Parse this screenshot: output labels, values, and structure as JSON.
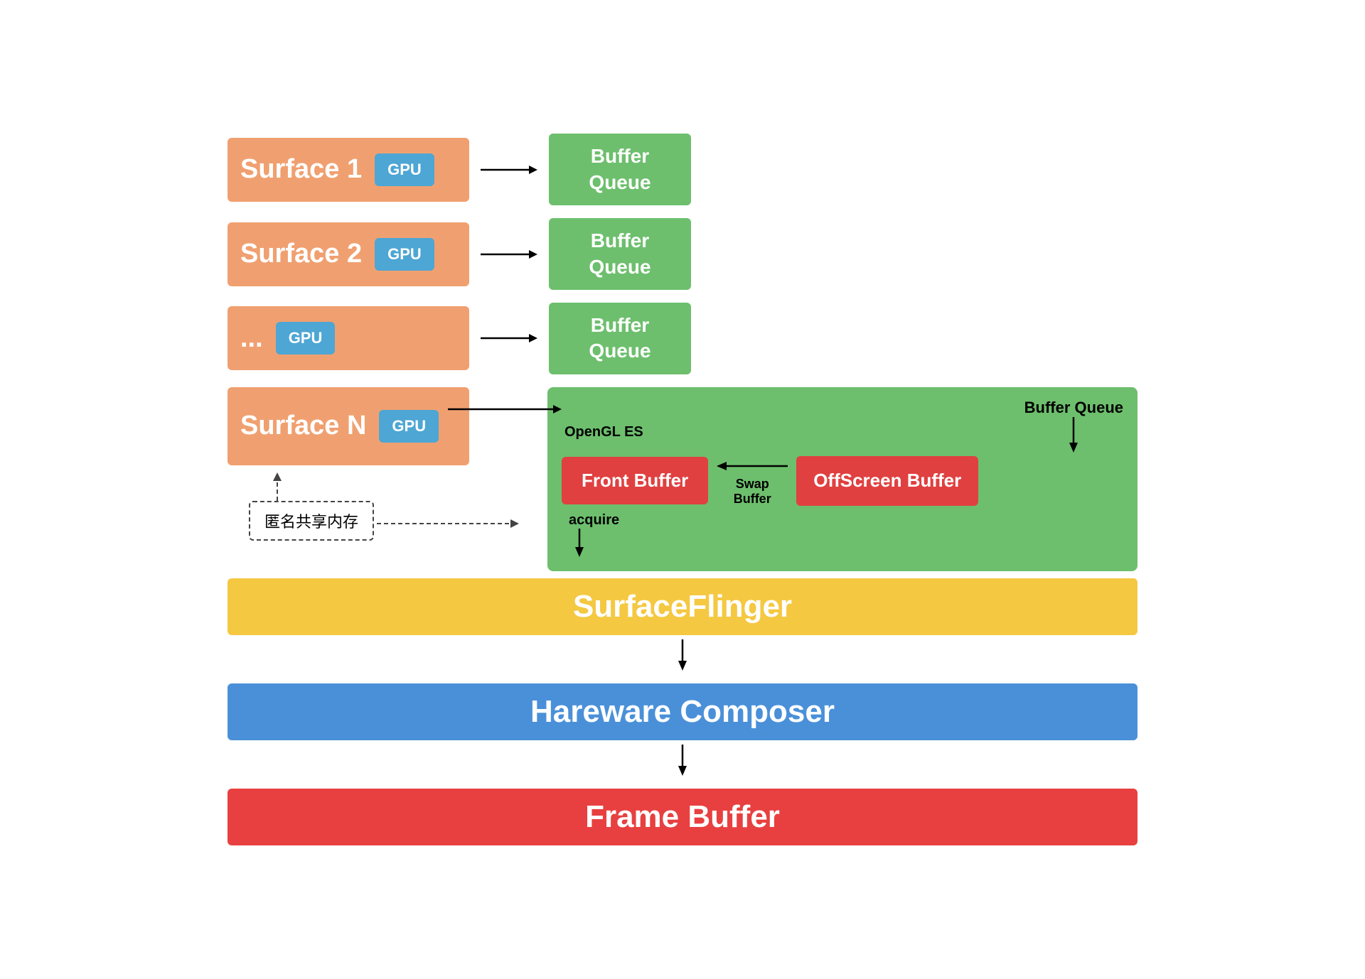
{
  "surfaces": [
    {
      "id": "surface1",
      "label": "Surface 1",
      "gpu": "GPU",
      "bufferQueue": "Buffer\nQueue"
    },
    {
      "id": "surface2",
      "label": "Surface 2",
      "gpu": "GPU",
      "bufferQueue": "Buffer\nQueue"
    },
    {
      "id": "surfaceDots",
      "label": "...",
      "gpu": "GPU",
      "bufferQueue": "Buffer\nQueue"
    }
  ],
  "surfaceN": {
    "label": "Surface N",
    "gpu": "GPU",
    "openglLabel": "OpenGL ES",
    "bufferQueueLabel": "Buffer Queue",
    "frontBuffer": "Front Buffer",
    "swapLabel": "Swap\nBuffer",
    "offscreenBuffer": "OffScreen\nBuffer",
    "anonLabel": "匿名共享内存",
    "acquireLabel": "acquire"
  },
  "surfaceFlinger": {
    "label": "SurfaceFlinger"
  },
  "hwComposer": {
    "label": "Hareware Composer"
  },
  "frameBuffer": {
    "label": "Frame Buffer"
  },
  "colors": {
    "surface": "#f0a070",
    "gpu": "#4da6d4",
    "bufferQueue": "#6dbf6d",
    "frontBuffer": "#e04040",
    "offscreenBuffer": "#e04040",
    "greenBox": "#6dbf6d",
    "surfaceFlinger": "#f5c842",
    "hwComposer": "#4a90d9",
    "frameBuffer": "#e84040"
  }
}
